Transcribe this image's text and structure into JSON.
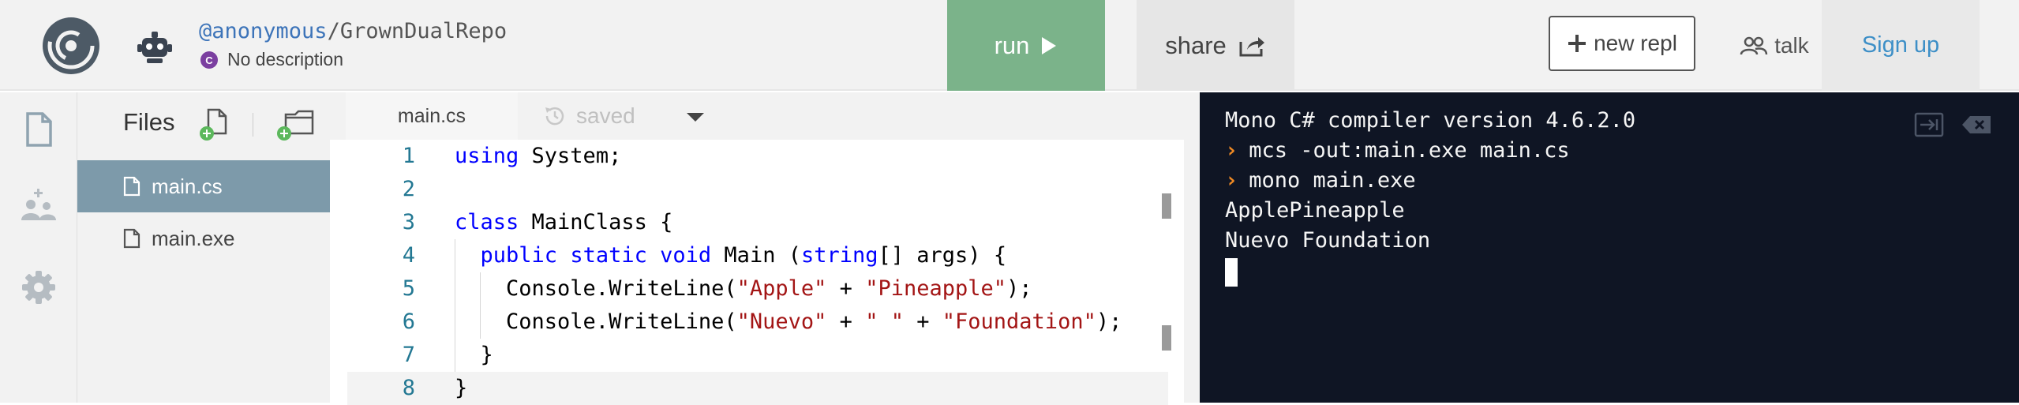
{
  "header": {
    "owner": "@anonymous",
    "separator": "/",
    "repl_name": "GrownDualRepo",
    "description": "No description",
    "run_label": "run",
    "share_label": "share",
    "new_repl_label": "new repl",
    "talk_label": "talk",
    "signup_label": "Sign up"
  },
  "files": {
    "title": "Files",
    "items": [
      {
        "name": "main.cs",
        "active": true
      },
      {
        "name": "main.exe",
        "active": false
      }
    ]
  },
  "editor": {
    "tab": "main.cs",
    "status": "saved",
    "lines": [
      {
        "n": "1",
        "parts": [
          [
            "kw",
            "using"
          ],
          [
            "",
            " System;"
          ]
        ]
      },
      {
        "n": "2",
        "parts": []
      },
      {
        "n": "3",
        "parts": [
          [
            "kw",
            "class"
          ],
          [
            "",
            " MainClass {"
          ]
        ]
      },
      {
        "n": "4",
        "parts": [
          [
            "",
            "  "
          ],
          [
            "kw",
            "public"
          ],
          [
            "",
            " "
          ],
          [
            "kw",
            "static"
          ],
          [
            "",
            " "
          ],
          [
            "kw",
            "void"
          ],
          [
            "",
            " Main ("
          ],
          [
            "kw",
            "string"
          ],
          [
            "",
            "[] args) {"
          ]
        ]
      },
      {
        "n": "5",
        "parts": [
          [
            "",
            "    Console.WriteLine("
          ],
          [
            "str",
            "\"Apple\""
          ],
          [
            "",
            " + "
          ],
          [
            "str",
            "\"Pineapple\""
          ],
          [
            "",
            ");"
          ]
        ]
      },
      {
        "n": "6",
        "parts": [
          [
            "",
            "    Console.WriteLine("
          ],
          [
            "str",
            "\"Nuevo\""
          ],
          [
            "",
            " + "
          ],
          [
            "str",
            "\" \""
          ],
          [
            "",
            " + "
          ],
          [
            "str",
            "\"Foundation\""
          ],
          [
            "",
            ");"
          ]
        ]
      },
      {
        "n": "7",
        "parts": [
          [
            "",
            "  }"
          ]
        ]
      },
      {
        "n": "8",
        "parts": [
          [
            "",
            "}"
          ]
        ]
      }
    ]
  },
  "console": {
    "lines": [
      {
        "prompt": false,
        "text": "Mono C# compiler version 4.6.2.0"
      },
      {
        "prompt": true,
        "text": "mcs -out:main.exe main.cs"
      },
      {
        "prompt": true,
        "text": "mono main.exe"
      },
      {
        "prompt": false,
        "text": "ApplePineapple"
      },
      {
        "prompt": false,
        "text": "Nuevo Foundation"
      }
    ]
  },
  "colors": {
    "run_button": "#7bb38a",
    "active_file": "#7d9aaa",
    "console_bg": "#0f1524",
    "link": "#3d8fc7",
    "prompt": "#f08a24"
  },
  "icons": [
    "replit-logo-icon",
    "robot-avatar-icon",
    "csharp-language-icon",
    "play-icon",
    "share-icon",
    "plus-icon",
    "people-icon",
    "file-icon",
    "users-icon",
    "gear-icon",
    "new-file-icon",
    "new-folder-icon",
    "history-icon",
    "chevron-down-icon",
    "enter-icon",
    "clear-icon"
  ]
}
